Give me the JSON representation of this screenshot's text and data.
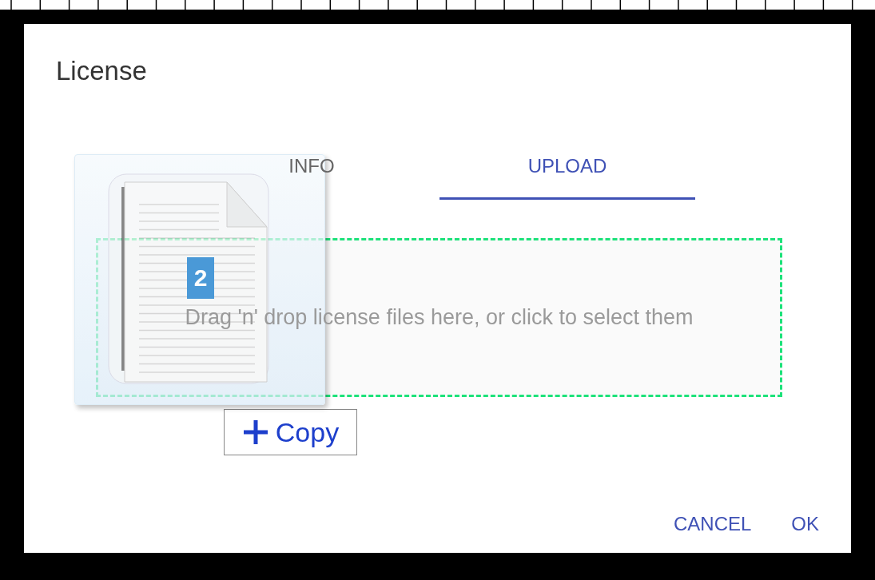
{
  "dialog": {
    "title": "License",
    "tabs": [
      {
        "label": "INFO",
        "selected": false
      },
      {
        "label": "UPLOAD",
        "selected": true
      }
    ],
    "dropzone": {
      "text": "Drag 'n' drop license files here, or click to select them"
    },
    "buttons": [
      {
        "label": "CANCEL"
      },
      {
        "label": "OK"
      }
    ]
  },
  "drag_ghost": {
    "count": "2",
    "action": "Copy"
  }
}
